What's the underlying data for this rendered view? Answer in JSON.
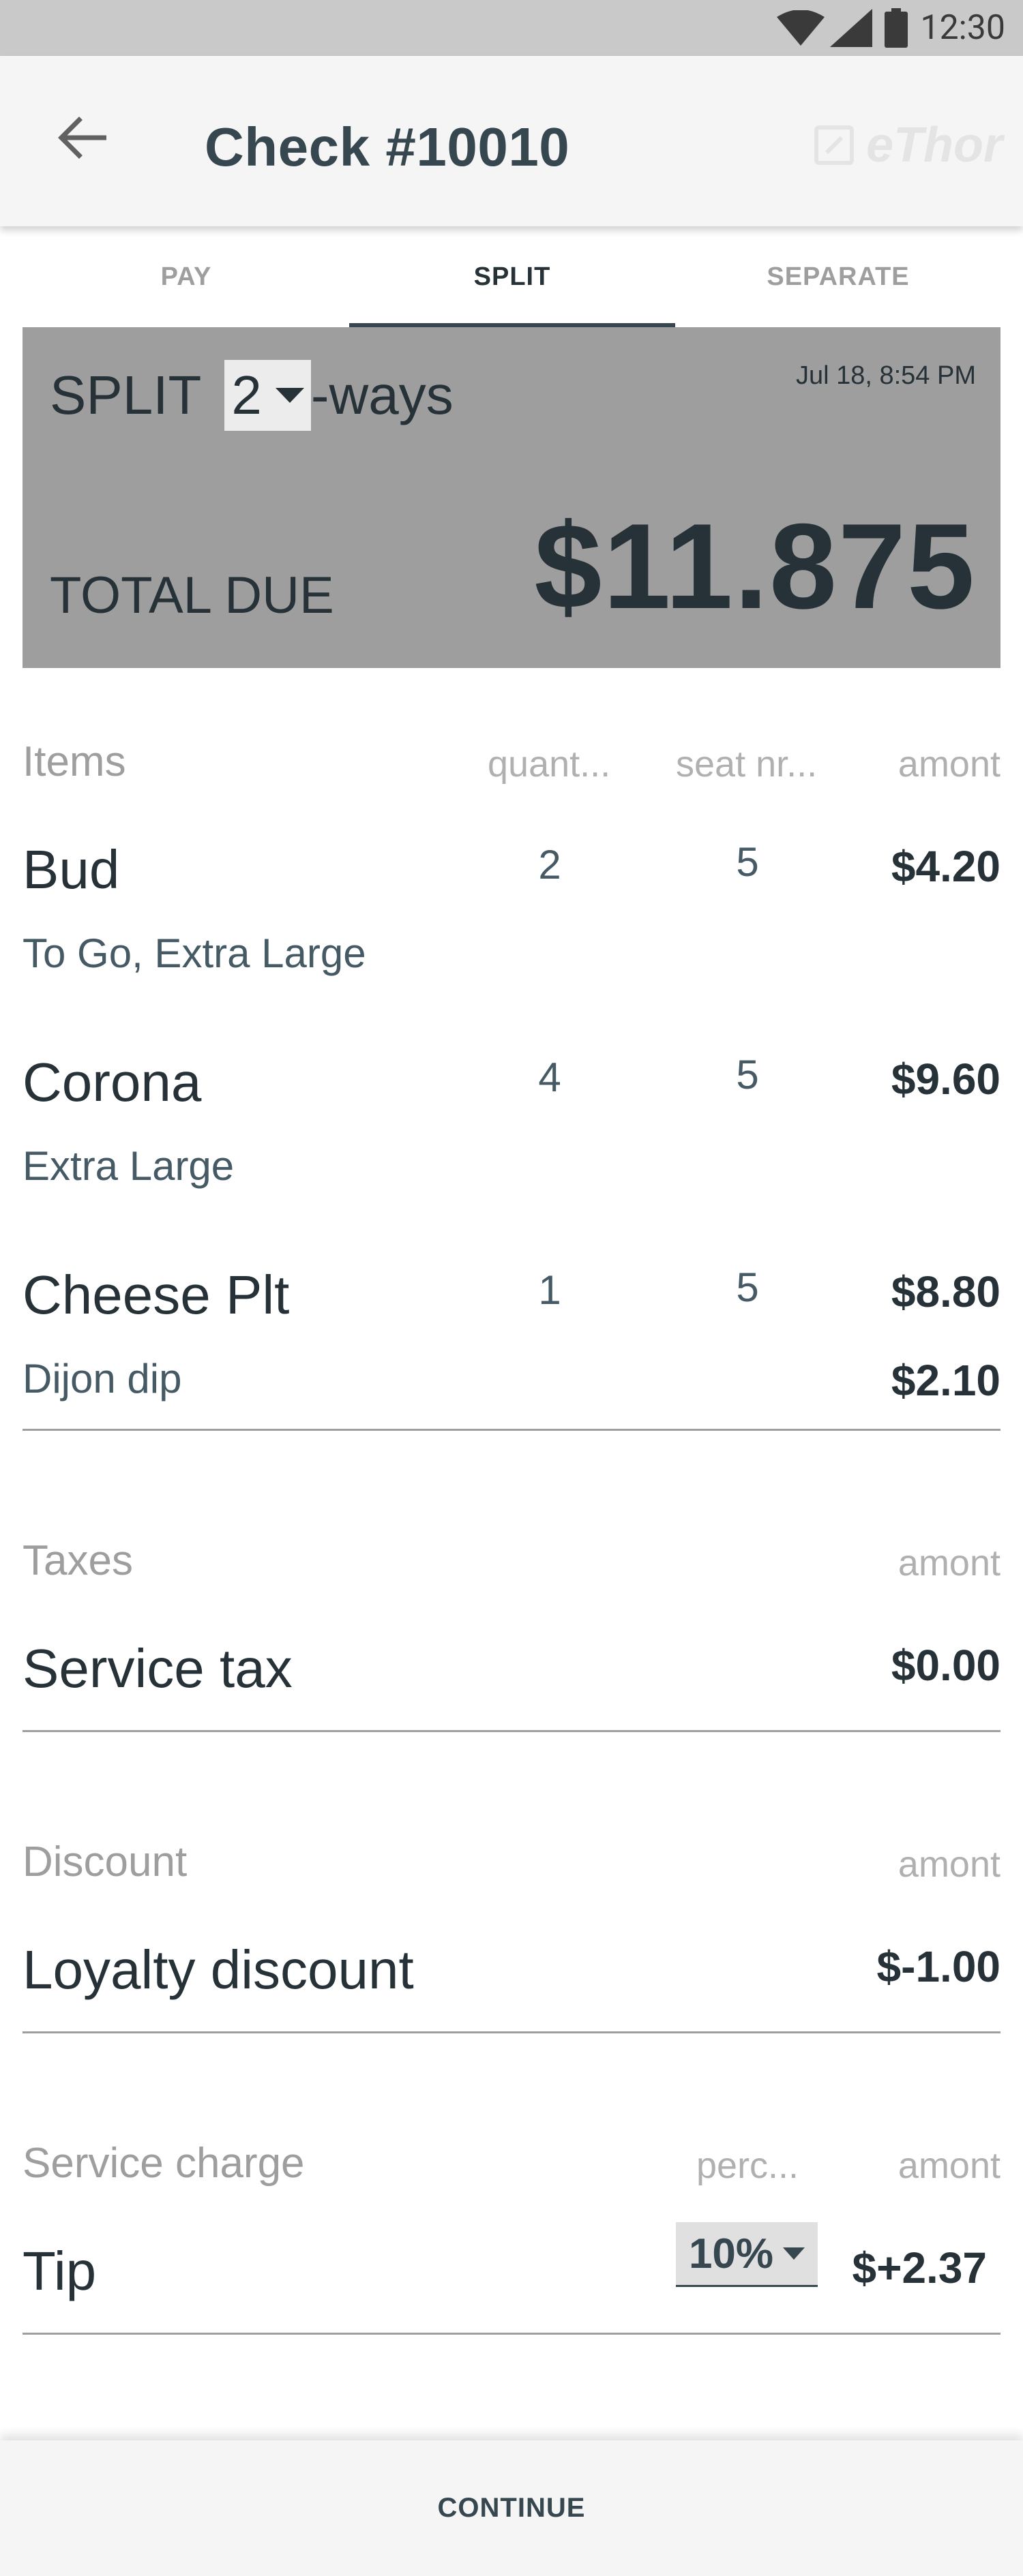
{
  "status_bar": {
    "time": "12:30"
  },
  "app_bar": {
    "title": "Check #10010",
    "logo_text": "eThor"
  },
  "tabs": [
    {
      "label": "PAY",
      "active": false
    },
    {
      "label": "SPLIT",
      "active": true
    },
    {
      "label": "SEPARATE",
      "active": false
    }
  ],
  "summary": {
    "split_prefix": "SPLIT",
    "split_value": "2",
    "split_suffix": "-ways",
    "datetime": "Jul 18, 8:54 PM",
    "total_label": "TOTAL DUE",
    "total_value": "$11.875"
  },
  "items_section": {
    "header": "Items",
    "col_quantity": "quant...",
    "col_seat": "seat nr...",
    "col_amount": "amont",
    "rows": [
      {
        "name": "Bud",
        "quantity": "2",
        "seat": "5",
        "amount": "$4.20",
        "modifier": "To Go, Extra Large",
        "modifier_amount": ""
      },
      {
        "name": "Corona",
        "quantity": "4",
        "seat": "5",
        "amount": "$9.60",
        "modifier": "Extra Large",
        "modifier_amount": ""
      },
      {
        "name": "Cheese Plt",
        "quantity": "1",
        "seat": "5",
        "amount": "$8.80",
        "modifier": "Dijon dip",
        "modifier_amount": "$2.10"
      }
    ]
  },
  "taxes_section": {
    "header": "Taxes",
    "col_amount": "amont",
    "row": {
      "name": "Service tax",
      "amount": "$0.00"
    }
  },
  "discount_section": {
    "header": "Discount",
    "col_amount": "amont",
    "row": {
      "name": "Loyalty discount",
      "amount": "$-1.00"
    }
  },
  "service_section": {
    "header": "Service charge",
    "col_percent": "perc...",
    "col_amount": "amont",
    "row": {
      "name": "Tip",
      "percent": "10%",
      "amount": "$+2.37"
    }
  },
  "footer": {
    "continue_label": "CONTINUE"
  },
  "colors": {
    "header_bg": "#9e9e9e",
    "text": "#263238",
    "muted": "#9e9e9e"
  }
}
